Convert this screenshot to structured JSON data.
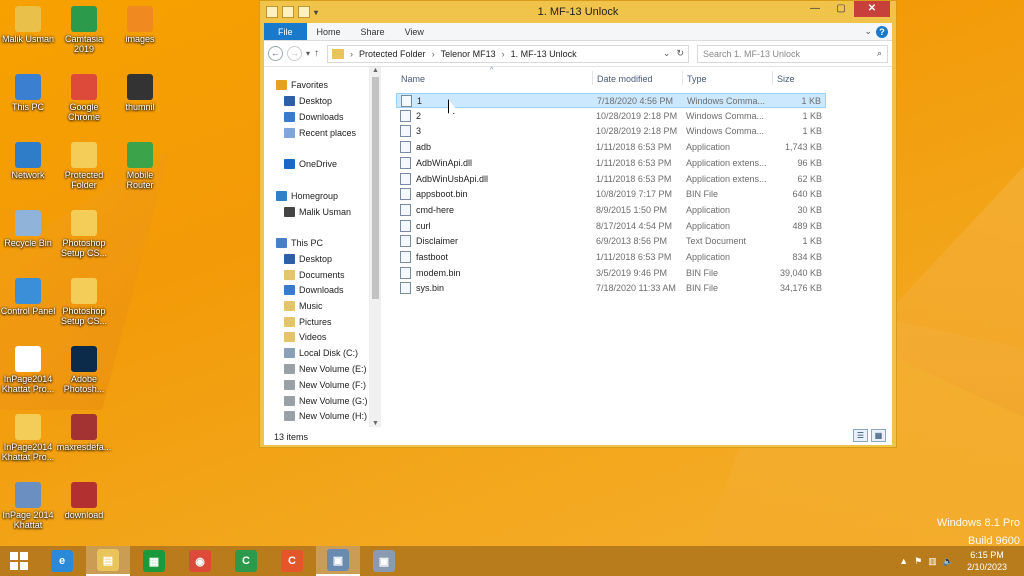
{
  "desktop": {
    "icons": [
      {
        "label": "Malik Usman",
        "icon": "user-folder-icon",
        "color": "#e8c04a"
      },
      {
        "label": "Camtasia 2019",
        "icon": "camtasia-icon",
        "color": "#2b9a4a"
      },
      {
        "label": "images",
        "icon": "folder-icon",
        "color": "#f08a20"
      },
      {
        "label": "This PC",
        "icon": "computer-icon",
        "color": "#3b7fd0"
      },
      {
        "label": "Google Chrome",
        "icon": "chrome-icon",
        "color": "#de4a3a"
      },
      {
        "label": "thumnil",
        "icon": "image-file-icon",
        "color": "#333333"
      },
      {
        "label": "Network",
        "icon": "network-icon",
        "color": "#2f7dc8"
      },
      {
        "label": "Protected Folder",
        "icon": "folder-icon",
        "color": "#f3cd57"
      },
      {
        "label": "Mobile Router",
        "icon": "lte-icon",
        "color": "#3ba34a"
      },
      {
        "label": "Recycle Bin",
        "icon": "recycle-bin-icon",
        "color": "#8fb3d9"
      },
      {
        "label": "Photoshop Setup CS...",
        "icon": "folder-icon",
        "color": "#f3cd57"
      },
      {
        "label": "Control Panel",
        "icon": "control-panel-icon",
        "color": "#3b8fd8"
      },
      {
        "label": "Photoshop Setup CS...",
        "icon": "folder-icon",
        "color": "#f3cd57"
      },
      {
        "label": "InPage2014 Khattat Pro...",
        "icon": "document-icon",
        "color": "#ffffff"
      },
      {
        "label": "Adobe Photosh...",
        "icon": "photoshop-icon",
        "color": "#0c2a4a"
      },
      {
        "label": "InPage2014 Khattat Pro...",
        "icon": "folder-icon",
        "color": "#f3cd57"
      },
      {
        "label": "maxresdefa...",
        "icon": "image-file-icon",
        "color": "#a33333"
      },
      {
        "label": "InPage 2014 Khattat",
        "icon": "inpage-icon",
        "color": "#6b8fc0"
      },
      {
        "label": "download",
        "icon": "image-file-icon",
        "color": "#b23030"
      }
    ]
  },
  "window": {
    "title": "1. MF-13 Unlock",
    "tabs": [
      "File",
      "Home",
      "Share",
      "View"
    ],
    "address": [
      "Protected Folder",
      "Telenor MF13",
      "1. MF-13 Unlock"
    ],
    "search_placeholder": "Search 1. MF-13 Unlock",
    "nav": [
      {
        "label": "Favorites",
        "icon": "star-icon",
        "color": "#e8a020"
      },
      {
        "label": "Desktop",
        "icon": "desktop-icon",
        "color": "#2f5ea8"
      },
      {
        "label": "Downloads",
        "icon": "downloads-icon",
        "color": "#3a7bd0"
      },
      {
        "label": "Recent places",
        "icon": "recent-places-icon",
        "color": "#7fa6d8"
      },
      {
        "label": "OneDrive",
        "icon": "onedrive-icon",
        "color": "#1a66c9"
      },
      {
        "label": "Homegroup",
        "icon": "homegroup-icon",
        "color": "#2e80c8"
      },
      {
        "label": "Malik Usman",
        "icon": "user-icon",
        "color": "#444444"
      },
      {
        "label": "This PC",
        "icon": "computer-icon",
        "color": "#4a7fc8"
      },
      {
        "label": "Desktop",
        "icon": "desktop-icon",
        "color": "#2f5ea8"
      },
      {
        "label": "Documents",
        "icon": "documents-icon",
        "color": "#e5c46a"
      },
      {
        "label": "Downloads",
        "icon": "downloads-icon",
        "color": "#3a7bd0"
      },
      {
        "label": "Music",
        "icon": "music-icon",
        "color": "#e5c46a"
      },
      {
        "label": "Pictures",
        "icon": "pictures-icon",
        "color": "#e5c46a"
      },
      {
        "label": "Videos",
        "icon": "videos-icon",
        "color": "#e5c46a"
      },
      {
        "label": "Local Disk (C:)",
        "icon": "drive-icon",
        "color": "#8aa0b8"
      },
      {
        "label": "New Volume (E:)",
        "icon": "drive-icon",
        "color": "#9aa0a8"
      },
      {
        "label": "New Volume (F:)",
        "icon": "drive-icon",
        "color": "#9aa0a8"
      },
      {
        "label": "New Volume (G:)",
        "icon": "drive-icon",
        "color": "#9aa0a8"
      },
      {
        "label": "New Volume (H:)",
        "icon": "drive-icon",
        "color": "#9aa0a8"
      }
    ],
    "columns": [
      "Name",
      "Date modified",
      "Type",
      "Size"
    ],
    "files": [
      {
        "name": "1",
        "date": "7/18/2020 4:56 PM",
        "type": "Windows Comma...",
        "size": "1 KB",
        "selected": true
      },
      {
        "name": "2",
        "date": "10/28/2019 2:18 PM",
        "type": "Windows Comma...",
        "size": "1 KB"
      },
      {
        "name": "3",
        "date": "10/28/2019 2:18 PM",
        "type": "Windows Comma...",
        "size": "1 KB"
      },
      {
        "name": "adb",
        "date": "1/11/2018 6:53 PM",
        "type": "Application",
        "size": "1,743 KB"
      },
      {
        "name": "AdbWinApi.dll",
        "date": "1/11/2018 6:53 PM",
        "type": "Application extens...",
        "size": "96 KB"
      },
      {
        "name": "AdbWinUsbApi.dll",
        "date": "1/11/2018 6:53 PM",
        "type": "Application extens...",
        "size": "62 KB"
      },
      {
        "name": "appsboot.bin",
        "date": "10/8/2019 7:17 PM",
        "type": "BIN File",
        "size": "640 KB"
      },
      {
        "name": "cmd-here",
        "date": "8/9/2015 1:50 PM",
        "type": "Application",
        "size": "30 KB"
      },
      {
        "name": "curl",
        "date": "8/17/2014 4:54 PM",
        "type": "Application",
        "size": "489 KB"
      },
      {
        "name": "Disclaimer",
        "date": "6/9/2013 8:56 PM",
        "type": "Text Document",
        "size": "1 KB"
      },
      {
        "name": "fastboot",
        "date": "1/11/2018 6:53 PM",
        "type": "Application",
        "size": "834 KB"
      },
      {
        "name": "modem.bin",
        "date": "3/5/2019 9:46 PM",
        "type": "BIN File",
        "size": "39,040 KB"
      },
      {
        "name": "sys.bin",
        "date": "7/18/2020 11:33 AM",
        "type": "BIN File",
        "size": "34,176 KB"
      }
    ],
    "status": "13 items"
  },
  "watermark": {
    "line1": "Windows 8.1 Pro",
    "line2": "Build 9600"
  },
  "taskbar": {
    "apps": [
      {
        "icon": "internet-explorer-icon",
        "color": "#2a8ad8",
        "glyph": "e"
      },
      {
        "icon": "file-explorer-icon",
        "color": "#e8c45a",
        "glyph": "▤",
        "active": true
      },
      {
        "icon": "store-icon",
        "color": "#1a9a3a",
        "glyph": "▦"
      },
      {
        "icon": "chrome-icon",
        "color": "#de4a3a",
        "glyph": "◉"
      },
      {
        "icon": "camtasia-icon",
        "color": "#2b9a4a",
        "glyph": "C"
      },
      {
        "icon": "camtasia-recorder-icon",
        "color": "#e4552a",
        "glyph": "C"
      },
      {
        "icon": "installer-icon",
        "color": "#6a8ab0",
        "glyph": "▣",
        "active": true
      },
      {
        "icon": "setup-icon",
        "color": "#8a9ab0",
        "glyph": "▣"
      }
    ],
    "time": "6:15 PM",
    "date": "2/10/2023"
  }
}
